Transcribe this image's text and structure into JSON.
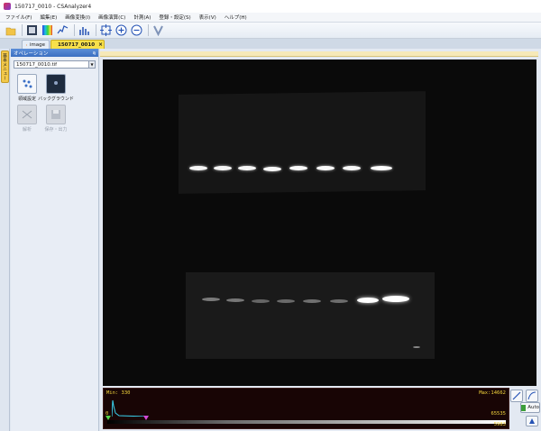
{
  "window": {
    "title": "150717_0010 - CSAnalyzer4"
  },
  "menu": [
    "ファイル(F)",
    "編集(E)",
    "画像変換(I)",
    "画像演算(C)",
    "計測(A)",
    "登録・設定(S)",
    "表示(V)",
    "ヘルプ(H)"
  ],
  "tabs": [
    {
      "label": "image"
    },
    {
      "label": "150717_0010"
    }
  ],
  "tab_close_symbol": "×",
  "side_tab": {
    "label": "基本メニュー"
  },
  "panel": {
    "header": "オペレーション",
    "pin_symbol": "ą",
    "file_select": "150717_0010.tif",
    "operations": [
      {
        "label": "領域設定",
        "enabled": true,
        "icon": "region-icon"
      },
      {
        "label": "バックグラウンド",
        "enabled": true,
        "icon": "background-icon"
      },
      {
        "label": "解析",
        "enabled": false,
        "icon": "analysis-icon"
      },
      {
        "label": "保存・出力",
        "enabled": false,
        "icon": "save-icon"
      }
    ]
  },
  "histogram": {
    "min_label": "Min: 330",
    "max_label": "Max:14662",
    "left_zero": "0",
    "right_top": "65535",
    "right_bottom": "5983"
  },
  "side_buttons": {
    "auto_label": "Auto"
  },
  "colors": {
    "accent_tab": "#f8e04a",
    "panel_header": "#3b6fc1",
    "histogram_text": "#f2d43c"
  }
}
